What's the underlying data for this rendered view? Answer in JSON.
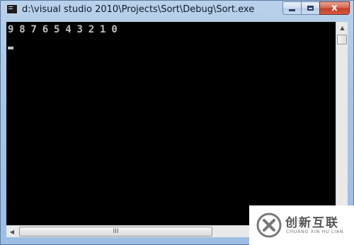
{
  "window": {
    "title": "d:\\visual studio 2010\\Projects\\Sort\\Debug\\Sort.exe",
    "icon": "console-app-icon",
    "buttons": {
      "minimize": "minimize-icon",
      "maximize": "maximize-icon",
      "close_glyph": "x"
    }
  },
  "console": {
    "output_line": "9 8 7 6 5 4 3 2 1 0",
    "background_color": "#000000",
    "text_color": "#c0c0c0"
  },
  "scrollbars": {
    "horizontal_thumb_grip": "III"
  },
  "watermark": {
    "brand_cn": "创新互联",
    "brand_en": "CHUANG XIN HU LIAN"
  }
}
